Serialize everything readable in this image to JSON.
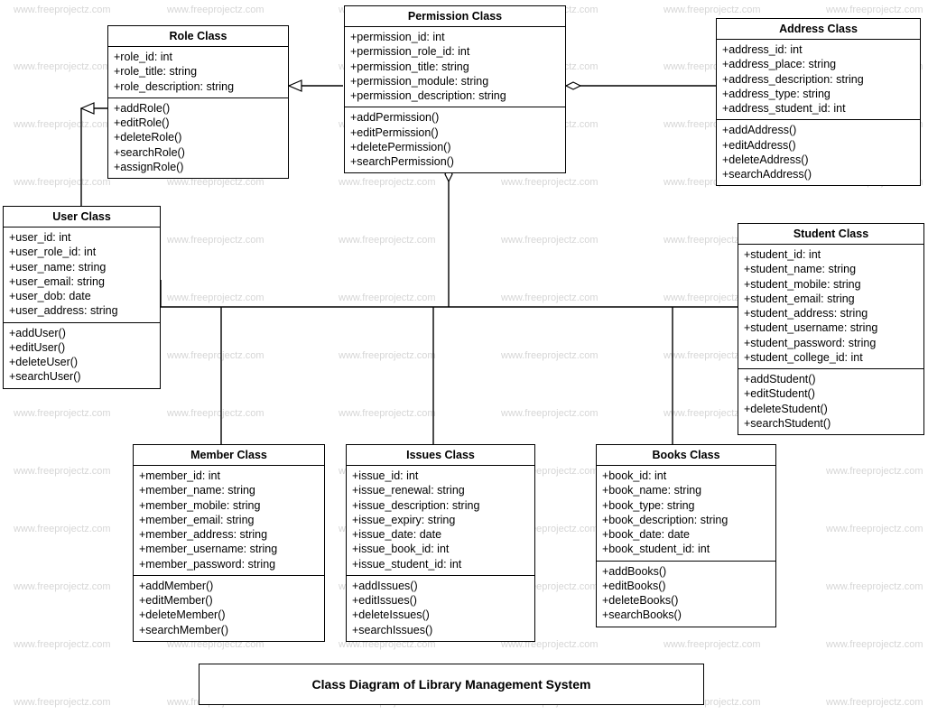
{
  "watermark_text": "www.freeprojectz.com",
  "diagram_title": "Class Diagram of Library Management System",
  "classes": {
    "role": {
      "title": "Role Class",
      "attrs": [
        "+role_id: int",
        "+role_title: string",
        "+role_description: string"
      ],
      "ops": [
        "+addRole()",
        "+editRole()",
        "+deleteRole()",
        "+searchRole()",
        "+assignRole()"
      ]
    },
    "permission": {
      "title": "Permission Class",
      "attrs": [
        "+permission_id: int",
        "+permission_role_id: int",
        "+permission_title: string",
        "+permission_module: string",
        "+permission_description: string"
      ],
      "ops": [
        "+addPermission()",
        "+editPermission()",
        "+deletePermission()",
        "+searchPermission()"
      ]
    },
    "address": {
      "title": "Address Class",
      "attrs": [
        "+address_id: int",
        "+address_place: string",
        "+address_description: string",
        "+address_type: string",
        "+address_student_id: int"
      ],
      "ops": [
        "+addAddress()",
        "+editAddress()",
        "+deleteAddress()",
        "+searchAddress()"
      ]
    },
    "user": {
      "title": "User Class",
      "attrs": [
        "+user_id: int",
        "+user_role_id: int",
        "+user_name: string",
        "+user_email: string",
        "+user_dob: date",
        "+user_address: string"
      ],
      "ops": [
        "+addUser()",
        "+editUser()",
        "+deleteUser()",
        "+searchUser()"
      ]
    },
    "student": {
      "title": "Student Class",
      "attrs": [
        "+student_id: int",
        "+student_name: string",
        "+student_mobile: string",
        "+student_email: string",
        "+student_address: string",
        "+student_username: string",
        "+student_password: string",
        "+student_college_id: int"
      ],
      "ops": [
        "+addStudent()",
        "+editStudent()",
        "+deleteStudent()",
        "+searchStudent()"
      ]
    },
    "member": {
      "title": "Member Class",
      "attrs": [
        "+member_id: int",
        "+member_name: string",
        "+member_mobile: string",
        "+member_email: string",
        "+member_address: string",
        "+member_username: string",
        "+member_password: string"
      ],
      "ops": [
        "+addMember()",
        "+editMember()",
        "+deleteMember()",
        "+searchMember()"
      ]
    },
    "issues": {
      "title": "Issues Class",
      "attrs": [
        "+issue_id: int",
        "+issue_renewal: string",
        "+issue_description: string",
        "+issue_expiry: string",
        "+issue_date: date",
        "+issue_book_id: int",
        "+issue_student_id: int"
      ],
      "ops": [
        "+addIssues()",
        "+editIssues()",
        "+deleteIssues()",
        "+searchIssues()"
      ]
    },
    "books": {
      "title": "Books Class",
      "attrs": [
        "+book_id: int",
        "+book_name: string",
        "+book_type: string",
        "+book_description: string",
        "+book_date: date",
        "+book_student_id: int"
      ],
      "ops": [
        "+addBooks()",
        "+editBooks()",
        "+deleteBooks()",
        "+searchBooks()"
      ]
    }
  }
}
